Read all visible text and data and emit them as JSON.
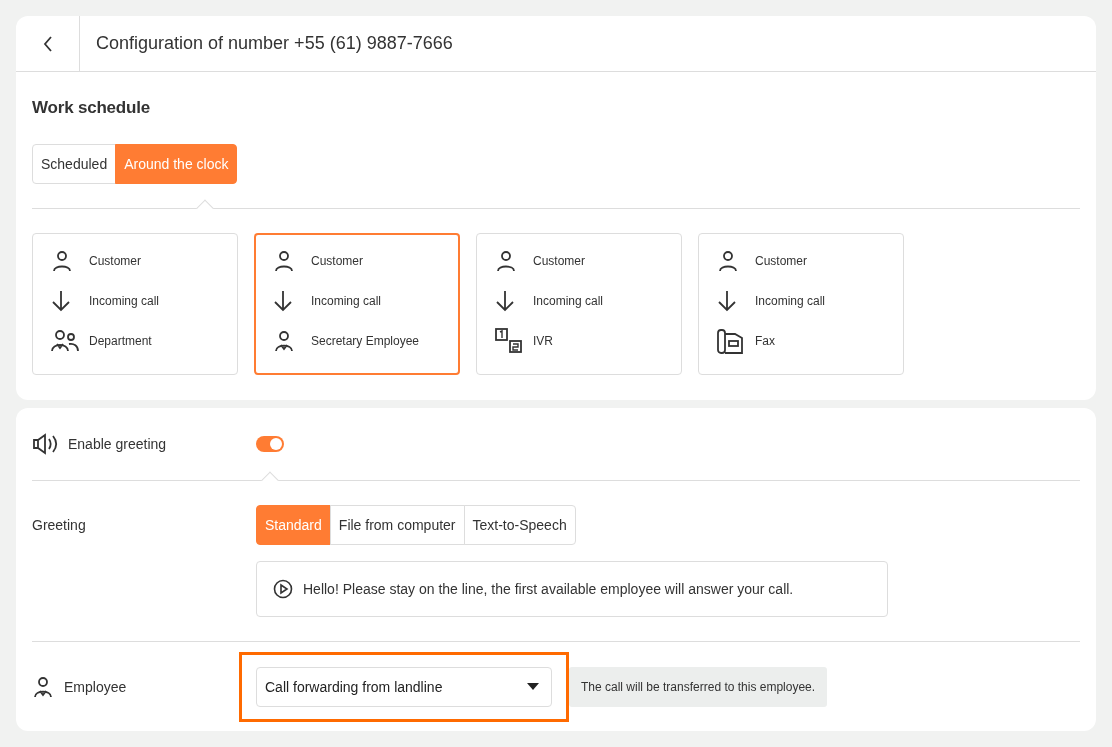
{
  "header": {
    "title": "Configuration of number +55 (61) 9887-7666"
  },
  "schedule": {
    "title": "Work schedule",
    "modes": [
      {
        "label": "Scheduled",
        "selected": false
      },
      {
        "label": "Around the clock",
        "selected": true
      }
    ]
  },
  "routes": [
    {
      "selected": false,
      "steps": [
        {
          "kind": "person",
          "label": "Customer"
        },
        {
          "kind": "arrow",
          "label": "Incoming call"
        },
        {
          "kind": "group",
          "label": "Department"
        }
      ]
    },
    {
      "selected": true,
      "steps": [
        {
          "kind": "person",
          "label": "Customer"
        },
        {
          "kind": "arrow",
          "label": "Incoming call"
        },
        {
          "kind": "employee",
          "label": "Secretary Employee"
        }
      ]
    },
    {
      "selected": false,
      "steps": [
        {
          "kind": "person",
          "label": "Customer"
        },
        {
          "kind": "arrow",
          "label": "Incoming call"
        },
        {
          "kind": "ivr",
          "label": "IVR"
        }
      ]
    },
    {
      "selected": false,
      "steps": [
        {
          "kind": "person",
          "label": "Customer"
        },
        {
          "kind": "arrow",
          "label": "Incoming call"
        },
        {
          "kind": "fax",
          "label": "Fax"
        }
      ]
    }
  ],
  "greeting_toggle": {
    "label": "Enable greeting",
    "on": true
  },
  "greeting": {
    "label": "Greeting",
    "options": [
      {
        "label": "Standard",
        "selected": true
      },
      {
        "label": "File from computer",
        "selected": false
      },
      {
        "label": "Text-to-Speech",
        "selected": false
      }
    ],
    "message": "Hello! Please stay on the line, the first available employee will answer your call."
  },
  "employee": {
    "label": "Employee",
    "value": "Call forwarding from landline",
    "highlighted": true,
    "hint": "The call will be transferred to this employee."
  }
}
